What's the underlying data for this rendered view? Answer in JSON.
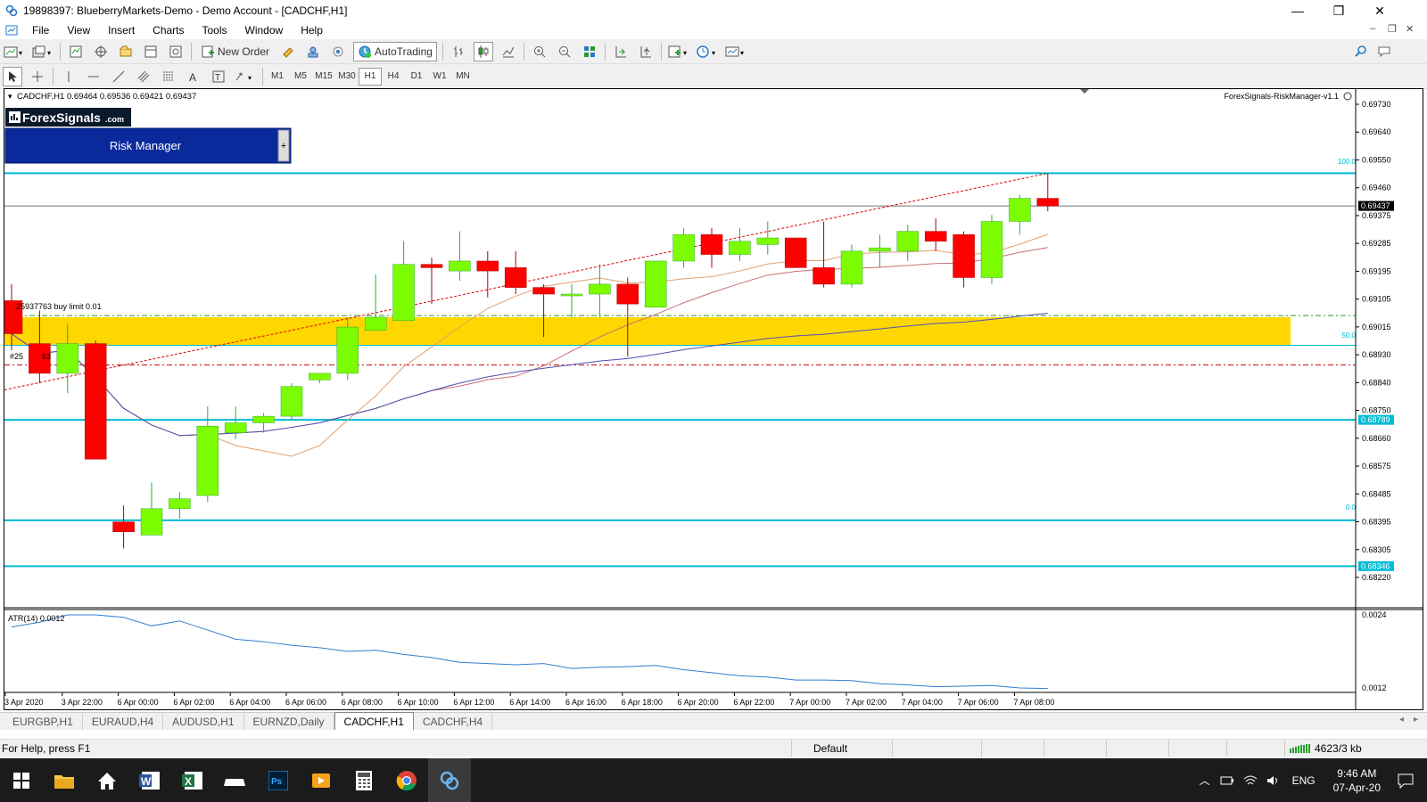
{
  "window": {
    "title": "19898397: BlueberryMarkets-Demo - Demo Account - [CADCHF,H1]",
    "min_glyph": "—",
    "max_glyph": "❐",
    "close_glyph": "✕"
  },
  "menu": [
    "File",
    "View",
    "Insert",
    "Charts",
    "Tools",
    "Window",
    "Help"
  ],
  "toolbar": {
    "new_order_label": "New Order",
    "autotrading_label": "AutoTrading"
  },
  "timeframes": [
    "M1",
    "M5",
    "M15",
    "M30",
    "H1",
    "H4",
    "D1",
    "W1",
    "MN"
  ],
  "active_timeframe": "H1",
  "chart": {
    "header": "CADCHF,H1  0.69464 0.69536 0.69421 0.69437",
    "indicator_name": "ForexSignals-RiskManager-v1.1",
    "logo_text": "ForexSignals",
    "logo_suffix": ".com",
    "risk_manager_label": "Risk Manager",
    "risk_manager_btn": "+",
    "order_label": "25937763 buy limit 0.01",
    "order_label_2": "#25",
    "order_label_3": "63",
    "fib_100": "100.0",
    "fib_50": "50.0",
    "fib_0": "0.0",
    "current_price": "0.69437",
    "line_price_1": "0.68789",
    "line_price_2": "0.68346",
    "price_scale": [
      "0.69730",
      "0.69640",
      "0.69550",
      "0.69460",
      "0.69375",
      "0.69285",
      "0.69195",
      "0.69105",
      "0.69015",
      "0.68930",
      "0.68840",
      "0.68750",
      "0.68660",
      "0.68575",
      "0.68485",
      "0.68395",
      "0.68305",
      "0.68220"
    ],
    "time_labels": [
      "3 Apr 2020",
      "3 Apr 22:00",
      "6 Apr 00:00",
      "6 Apr 02:00",
      "6 Apr 04:00",
      "6 Apr 06:00",
      "6 Apr 08:00",
      "6 Apr 10:00",
      "6 Apr 12:00",
      "6 Apr 14:00",
      "6 Apr 16:00",
      "6 Apr 18:00",
      "6 Apr 20:00",
      "6 Apr 22:00",
      "7 Apr 00:00",
      "7 Apr 02:00",
      "7 Apr 04:00",
      "7 Apr 06:00",
      "7 Apr 08:00"
    ],
    "atr_label": "ATR(14) 0.0012",
    "atr_scale": [
      "0.0024",
      "0.0012"
    ],
    "colors": {
      "bull": "#7cfc00",
      "bear": "#ff0000",
      "zone": "#ffd700",
      "cyan": "#00bcd4"
    }
  },
  "chart_data": {
    "type": "candlestick",
    "symbol": "CADCHF",
    "timeframe": "H1",
    "ylim": [
      0.6822,
      0.6978
    ],
    "candles": [
      {
        "o": 0.6915,
        "h": 0.692,
        "l": 0.69,
        "c": 0.6905
      },
      {
        "o": 0.6902,
        "h": 0.6912,
        "l": 0.689,
        "c": 0.6893
      },
      {
        "o": 0.6893,
        "h": 0.6908,
        "l": 0.6887,
        "c": 0.6902
      },
      {
        "o": 0.6902,
        "h": 0.6903,
        "l": 0.6867,
        "c": 0.6867
      },
      {
        "o": 0.6848,
        "h": 0.6853,
        "l": 0.684,
        "c": 0.6845
      },
      {
        "o": 0.6844,
        "h": 0.686,
        "l": 0.6844,
        "c": 0.6852
      },
      {
        "o": 0.6852,
        "h": 0.6857,
        "l": 0.6849,
        "c": 0.6855
      },
      {
        "o": 0.6856,
        "h": 0.6883,
        "l": 0.6854,
        "c": 0.6877
      },
      {
        "o": 0.6875,
        "h": 0.6883,
        "l": 0.6873,
        "c": 0.6878
      },
      {
        "o": 0.6878,
        "h": 0.6881,
        "l": 0.6875,
        "c": 0.688
      },
      {
        "o": 0.688,
        "h": 0.689,
        "l": 0.6879,
        "c": 0.6889
      },
      {
        "o": 0.6891,
        "h": 0.6893,
        "l": 0.689,
        "c": 0.6893
      },
      {
        "o": 0.6893,
        "h": 0.691,
        "l": 0.6891,
        "c": 0.6907
      },
      {
        "o": 0.6906,
        "h": 0.6923,
        "l": 0.6906,
        "c": 0.691
      },
      {
        "o": 0.6909,
        "h": 0.6933,
        "l": 0.6909,
        "c": 0.6926
      },
      {
        "o": 0.6926,
        "h": 0.6928,
        "l": 0.6914,
        "c": 0.6925
      },
      {
        "o": 0.6924,
        "h": 0.6936,
        "l": 0.6921,
        "c": 0.6927
      },
      {
        "o": 0.6927,
        "h": 0.693,
        "l": 0.6916,
        "c": 0.6924
      },
      {
        "o": 0.6925,
        "h": 0.693,
        "l": 0.6917,
        "c": 0.6919
      },
      {
        "o": 0.6919,
        "h": 0.692,
        "l": 0.6904,
        "c": 0.6917
      },
      {
        "o": 0.6917,
        "h": 0.692,
        "l": 0.691,
        "c": 0.6917
      },
      {
        "o": 0.6917,
        "h": 0.6926,
        "l": 0.691,
        "c": 0.692
      },
      {
        "o": 0.692,
        "h": 0.6922,
        "l": 0.6898,
        "c": 0.6914
      },
      {
        "o": 0.6913,
        "h": 0.6927,
        "l": 0.6913,
        "c": 0.6927
      },
      {
        "o": 0.6927,
        "h": 0.6937,
        "l": 0.6925,
        "c": 0.6935
      },
      {
        "o": 0.6935,
        "h": 0.6937,
        "l": 0.6925,
        "c": 0.6929
      },
      {
        "o": 0.6929,
        "h": 0.6937,
        "l": 0.6927,
        "c": 0.6933
      },
      {
        "o": 0.6932,
        "h": 0.6939,
        "l": 0.6929,
        "c": 0.6934
      },
      {
        "o": 0.6934,
        "h": 0.6934,
        "l": 0.6925,
        "c": 0.6925
      },
      {
        "o": 0.6925,
        "h": 0.6939,
        "l": 0.6919,
        "c": 0.692
      },
      {
        "o": 0.692,
        "h": 0.6932,
        "l": 0.6919,
        "c": 0.693
      },
      {
        "o": 0.693,
        "h": 0.6935,
        "l": 0.6925,
        "c": 0.6931
      },
      {
        "o": 0.693,
        "h": 0.6938,
        "l": 0.6927,
        "c": 0.6936
      },
      {
        "o": 0.6936,
        "h": 0.694,
        "l": 0.693,
        "c": 0.6933
      },
      {
        "o": 0.6935,
        "h": 0.6936,
        "l": 0.6919,
        "c": 0.6922
      },
      {
        "o": 0.6922,
        "h": 0.6941,
        "l": 0.692,
        "c": 0.6939
      },
      {
        "o": 0.6939,
        "h": 0.6947,
        "l": 0.6935,
        "c": 0.6946
      },
      {
        "o": 0.6946,
        "h": 0.69536,
        "l": 0.69421,
        "c": 0.69437
      }
    ],
    "horizontal_lines": [
      0.69536,
      0.69437,
      0.68789,
      0.68485,
      0.68346
    ],
    "zone": [
      0.69015,
      0.691
    ],
    "atr": {
      "name": "ATR(14)",
      "last": 0.0012,
      "ylim": [
        0.0012,
        0.0024
      ]
    }
  },
  "tabs": [
    "EURGBP,H1",
    "EURAUD,H4",
    "AUDUSD,H1",
    "EURNZD,Daily",
    "CADCHF,H1",
    "CADCHF,H4"
  ],
  "active_tab": "CADCHF,H1",
  "status": {
    "help": "For Help, press F1",
    "profile": "Default",
    "traffic": "4623/3 kb"
  },
  "taskbar": {
    "lang": "ENG",
    "time": "9:46 AM",
    "date": "07-Apr-20"
  }
}
